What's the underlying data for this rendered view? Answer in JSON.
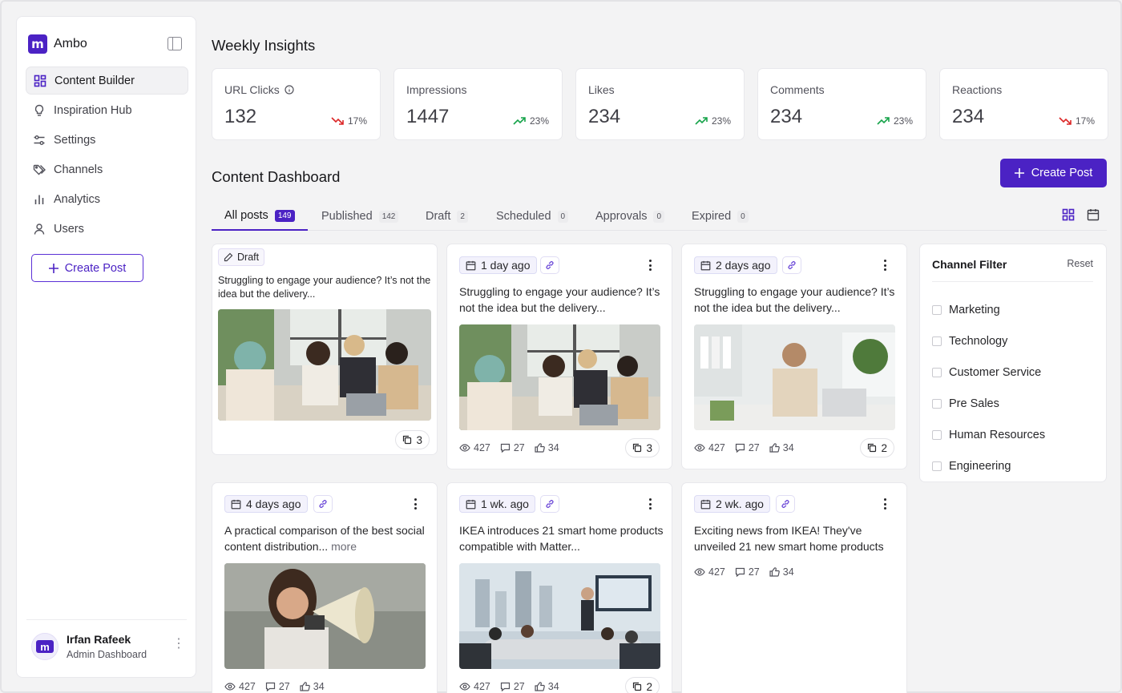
{
  "brand": {
    "name": "Ambo",
    "logo_letter": "m"
  },
  "sidebar": {
    "items": [
      {
        "label": "Content Builder",
        "icon": "layout-icon"
      },
      {
        "label": "Inspiration Hub",
        "icon": "lightbulb-icon"
      },
      {
        "label": "Settings",
        "icon": "sliders-icon"
      },
      {
        "label": "Channels",
        "icon": "tags-icon"
      },
      {
        "label": "Analytics",
        "icon": "bar-chart-icon"
      },
      {
        "label": "Users",
        "icon": "user-icon"
      }
    ],
    "create_label": "Create Post"
  },
  "user": {
    "name": "Irfan Rafeek",
    "role": "Admin Dashboard",
    "avatar_letter": "m"
  },
  "insights": {
    "title": "Weekly Insights",
    "stats": [
      {
        "label": "URL Clicks",
        "value": "132",
        "trend": "17%",
        "direction": "down"
      },
      {
        "label": "Impressions",
        "value": "1447",
        "trend": "23%",
        "direction": "up"
      },
      {
        "label": "Likes",
        "value": "234",
        "trend": "23%",
        "direction": "up"
      },
      {
        "label": "Comments",
        "value": "234",
        "trend": "23%",
        "direction": "up"
      },
      {
        "label": "Reactions",
        "value": "234",
        "trend": "17%",
        "direction": "down"
      }
    ]
  },
  "dashboard": {
    "title": "Content Dashboard",
    "create_label": "Create Post",
    "tabs": [
      {
        "label": "All posts",
        "count": "149"
      },
      {
        "label": "Published",
        "count": "142"
      },
      {
        "label": "Draft",
        "count": "2"
      },
      {
        "label": "Scheduled",
        "count": "0"
      },
      {
        "label": "Approvals",
        "count": "0"
      },
      {
        "label": "Expired",
        "count": "0"
      }
    ]
  },
  "posts": [
    {
      "badge": "Draft",
      "text": "Struggling to engage your audience? It’s not the idea but the delivery...",
      "copies": "3",
      "image": "team-meeting-photo"
    },
    {
      "time": "1 day ago",
      "text": "Struggling to engage your audience? It’s not the idea but the delivery...",
      "views": "427",
      "comments": "27",
      "likes": "34",
      "copies": "3",
      "image": "team-meeting-photo"
    },
    {
      "time": "2 days ago",
      "text": "Struggling to engage your audience? It’s not the idea but the delivery...",
      "views": "427",
      "comments": "27",
      "likes": "34",
      "copies": "2",
      "image": "man-with-phone-photo"
    },
    {
      "time": "4 days ago",
      "text": "A practical comparison of the best social content distribution...",
      "more": "more",
      "views": "427",
      "comments": "27",
      "likes": "34",
      "image": "woman-megaphone-photo"
    },
    {
      "time": "1 wk. ago",
      "text": "IKEA introduces 21 smart home products compatible with Matter...",
      "views": "427",
      "comments": "27",
      "likes": "34",
      "copies": "2",
      "image": "boardroom-presentation-photo"
    },
    {
      "time": "2 wk. ago",
      "text": "Exciting news from IKEA! They've unveiled 21 new smart home products",
      "views": "427",
      "comments": "27",
      "likes": "34"
    }
  ],
  "filter": {
    "title": "Channel Filter",
    "reset": "Reset",
    "channels": [
      "Marketing",
      "Technology",
      "Customer Service",
      "Pre Sales",
      "Human Resources",
      "Engineering"
    ]
  },
  "colors": {
    "accent": "#4b22c4",
    "up": "#16a34a",
    "down": "#dc2626"
  }
}
